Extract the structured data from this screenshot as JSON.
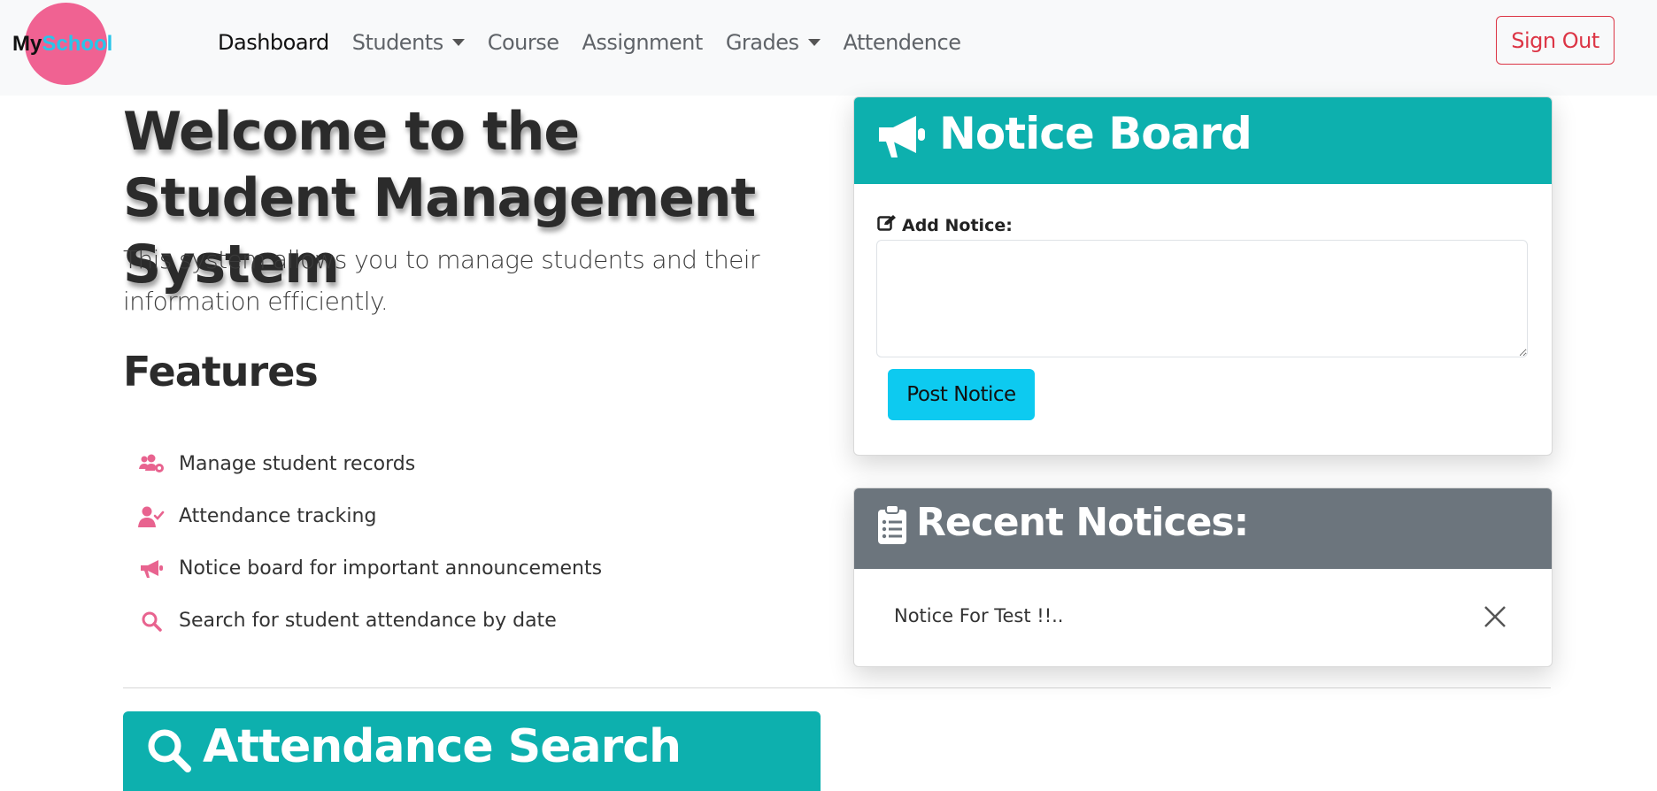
{
  "brand": {
    "my": "My",
    "school": "School",
    "circle_color": "#f06292"
  },
  "nav": {
    "items": [
      {
        "label": "Dashboard",
        "active": true,
        "dropdown": false
      },
      {
        "label": "Students",
        "active": false,
        "dropdown": true
      },
      {
        "label": "Course",
        "active": false,
        "dropdown": false
      },
      {
        "label": "Assignment",
        "active": false,
        "dropdown": false
      },
      {
        "label": "Grades",
        "active": false,
        "dropdown": true
      },
      {
        "label": "Attendence",
        "active": false,
        "dropdown": false
      }
    ],
    "signout_label": "Sign Out"
  },
  "hero": {
    "title": "Welcome to the Student Management System",
    "lead": "This system allows you to manage students and their information efficiently."
  },
  "features": {
    "heading": "Features",
    "items": [
      {
        "icon": "users-cog-icon",
        "label": "Manage student records"
      },
      {
        "icon": "user-check-icon",
        "label": "Attendance tracking"
      },
      {
        "icon": "megaphone-icon",
        "label": "Notice board for important announcements"
      },
      {
        "icon": "search-icon",
        "label": "Search for student attendance by date"
      }
    ],
    "icon_color": "#e8638f"
  },
  "notice_board": {
    "title": "Notice Board",
    "add_label": "Add Notice:",
    "textarea_value": "",
    "post_label": "Post Notice",
    "header_color": "#0db0ae"
  },
  "recent_notices": {
    "title": "Recent Notices:",
    "items": [
      {
        "text": "Notice For Test !!.."
      }
    ],
    "header_color": "#6c757d"
  },
  "attendance_search": {
    "title": "Attendance Search"
  }
}
